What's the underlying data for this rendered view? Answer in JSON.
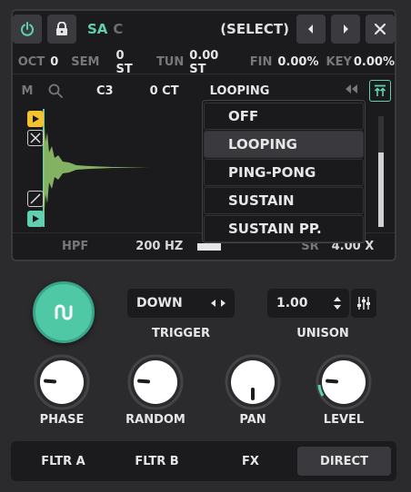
{
  "header": {
    "sa_label": "SA",
    "c_label": "C",
    "select_label": "(SELECT)",
    "icons": [
      "power-icon",
      "lock-icon",
      "arrow-left-icon",
      "arrow-right-icon",
      "close-icon"
    ]
  },
  "params": {
    "oct_label": "OCT",
    "oct_value": "0",
    "sem_label": "SEM",
    "sem_value": "0 ST",
    "tun_label": "TUN",
    "tun_value": "0.00 ST",
    "fin_label": "FIN",
    "fin_value": "0.00%",
    "key_label": "KEY",
    "key_value": "0.00%"
  },
  "sample": {
    "m_label": "M",
    "root_note": "C3",
    "cents": "0 CT",
    "loop_mode": "LOOPING"
  },
  "loop_dropdown": {
    "options": [
      "OFF",
      "LOOPING",
      "PING-PONG",
      "SUSTAIN",
      "SUSTAIN PP."
    ],
    "selected_index": 1
  },
  "filter": {
    "hpf_label": "HPF",
    "hpf_value": "200 HZ",
    "sr_label": "SR",
    "sr_value": "4.00 X"
  },
  "trigger": {
    "value": "DOWN",
    "label": "TRIGGER"
  },
  "unison": {
    "value": "1.00",
    "label": "UNISON"
  },
  "knobs": [
    {
      "label": "PHASE",
      "level": 0.15
    },
    {
      "label": "RANDOM",
      "level": 0.15
    },
    {
      "label": "PAN",
      "level": 0.5
    },
    {
      "label": "LEVEL",
      "level": 0.15
    }
  ],
  "tabs": [
    {
      "label": "FLTR A",
      "active": false
    },
    {
      "label": "FLTR B",
      "active": false
    },
    {
      "label": "FX",
      "active": false
    },
    {
      "label": "DIRECT",
      "active": true
    }
  ],
  "colors": {
    "accent": "#5fd1b0",
    "marker_yellow": "#f2c230",
    "marker_teal": "#5fd1b0",
    "wave_green": "#8fc46a",
    "panel_bg": "#1b1b1d",
    "outer_bg": "#2b2b2e"
  }
}
